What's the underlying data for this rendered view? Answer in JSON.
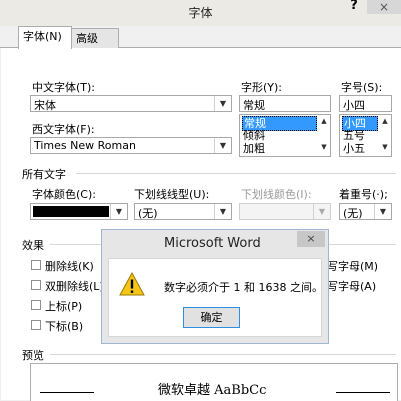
{
  "dialog": {
    "title": "字体",
    "help": "?",
    "close": "×"
  },
  "tabs": [
    {
      "label": "字体(N)"
    },
    {
      "label": "高级(V)"
    }
  ],
  "font": {
    "chinese_font_label": "中文字体(T):",
    "chinese_font_value": "宋体",
    "western_font_label": "西文字体(F):",
    "western_font_value": "Times New Roman",
    "style_label": "字形(Y):",
    "style_value": "常规",
    "style_options": [
      "常规",
      "倾斜",
      "加粗"
    ],
    "size_label": "字号(S):",
    "size_value": "小四",
    "size_options": [
      "小四",
      "五号",
      "小五"
    ]
  },
  "all_text": {
    "group_title": "所有文字",
    "font_color_label": "字体颜色(C):",
    "font_color": "#000000",
    "underline_type_label": "下划线线型(U):",
    "underline_type_value": "(无)",
    "underline_color_label": "下划线颜色(I):",
    "emphasis_label": "着重号(·);",
    "emphasis_value": "(无)"
  },
  "effects": {
    "group_title": "效果",
    "items": [
      "删除线(K)",
      "双删除线(L)",
      "上标(P)",
      "下标(B)"
    ],
    "right_items": [
      "写字母(M)",
      "写字母(A)"
    ]
  },
  "preview": {
    "group_title": "预览",
    "sample": "微软卓越 AaBbCc"
  },
  "message_box": {
    "title": "Microsoft Word",
    "close": "×",
    "text": "数字必须介于 1 和 1638 之间。",
    "ok_label": "确定"
  }
}
